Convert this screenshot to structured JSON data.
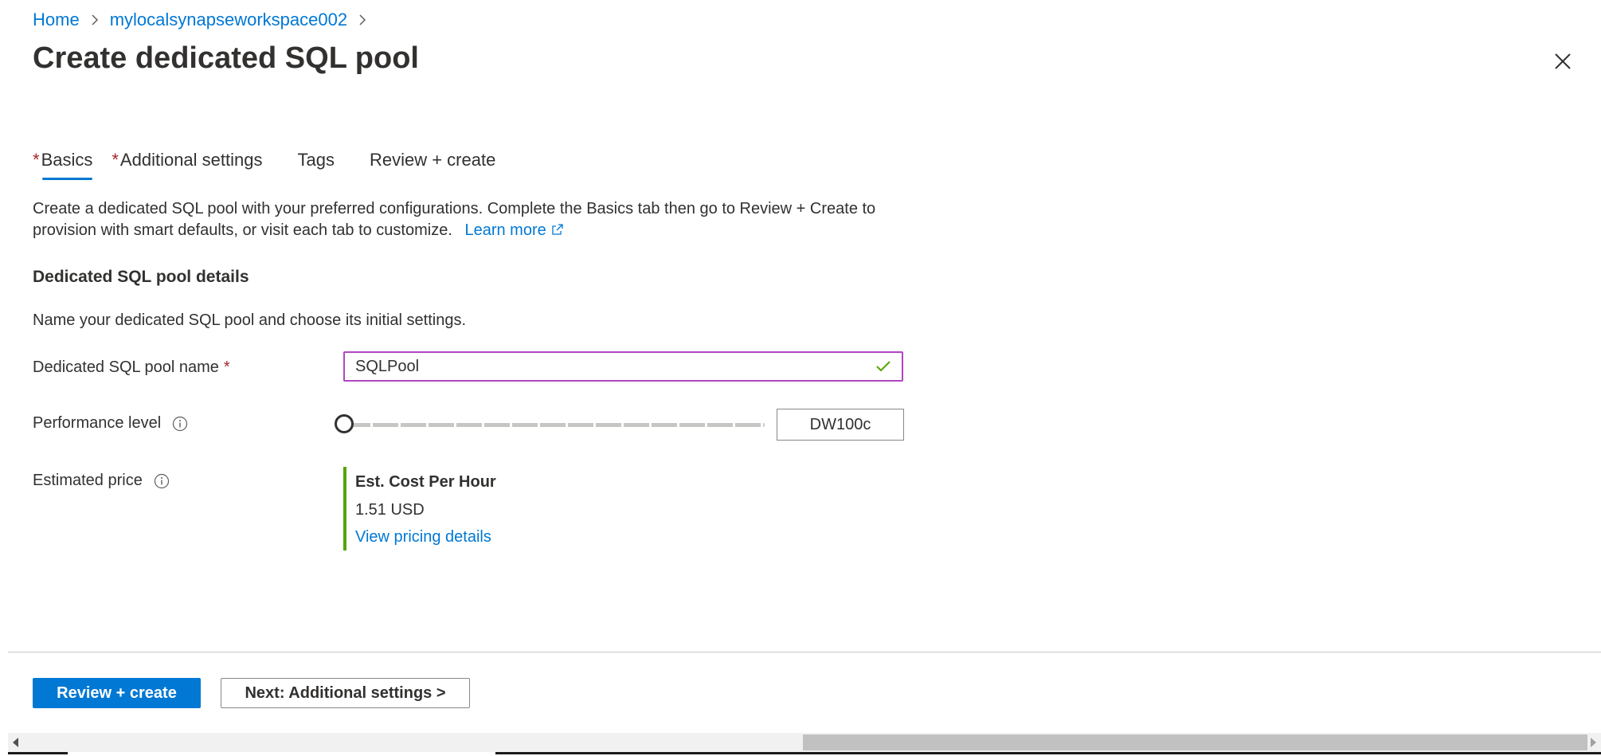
{
  "breadcrumb": {
    "home": "Home",
    "workspace": "mylocalsynapseworkspace002"
  },
  "page": {
    "title": "Create dedicated SQL pool"
  },
  "tabs": [
    {
      "label": "Basics",
      "required": true,
      "active": true
    },
    {
      "label": "Additional settings",
      "required": true,
      "active": false
    },
    {
      "label": "Tags",
      "required": false,
      "active": false
    },
    {
      "label": "Review + create",
      "required": false,
      "active": false
    }
  ],
  "intro": {
    "text": "Create a dedicated SQL pool with your preferred configurations. Complete the Basics tab then go to Review + Create to provision with smart defaults, or visit each tab to customize.",
    "learn_more": "Learn more"
  },
  "section": {
    "title": "Dedicated SQL pool details",
    "description": "Name your dedicated SQL pool and choose its initial settings."
  },
  "fields": {
    "pool_name_label": "Dedicated SQL pool name",
    "pool_name_required_mark": "*",
    "pool_name_value": "SQLPool",
    "performance_label": "Performance level",
    "performance_value": "DW100c",
    "performance_slider_position": 0,
    "estimated_price_label": "Estimated price"
  },
  "price": {
    "heading": "Est. Cost Per Hour",
    "amount": "1.51 USD",
    "details_link": "View pricing details"
  },
  "footer": {
    "primary_button": "Review + create",
    "secondary_button": "Next: Additional settings >"
  },
  "colors": {
    "accent": "#0078d4",
    "required": "#a4262c",
    "valid_check": "#57a300",
    "input_focus_border": "#b146c2",
    "price_bar": "#57a300"
  },
  "icons": {
    "close": "close-icon",
    "breadcrumb_separator": "chevron-right-icon",
    "info": "info-icon",
    "external_link": "external-link-icon",
    "valid": "checkmark-icon"
  }
}
